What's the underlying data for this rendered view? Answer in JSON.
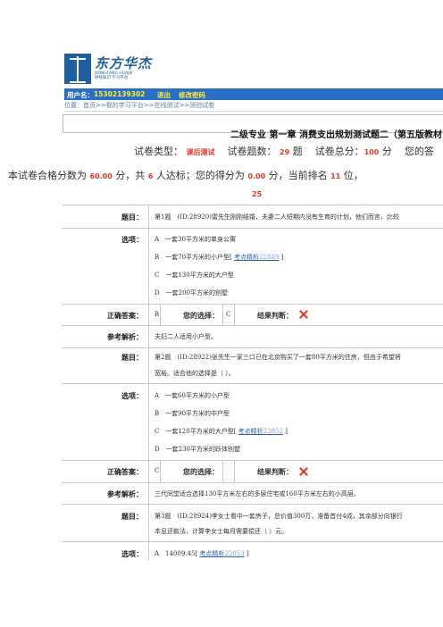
{
  "logo": {
    "name": "东方华杰",
    "tagline_1": "DONGFANG HUAJIE",
    "tagline_2": "财经知识 学习平台"
  },
  "header": {
    "user_label": "用户名：",
    "user_phone": "15302139302",
    "logout": "退出",
    "change_password": "修改密码"
  },
  "breadcrumb": "位置：首页>>我的学习平台>>在线测试>>测验试卷",
  "exam": {
    "title": "二级专业 第一章 消费支出规划测试题二（第五版教材",
    "type_label": "试卷类型：",
    "type_value": "课后测试",
    "count_label": "试卷题数：",
    "count_value": "29",
    "count_unit": "题",
    "total_label": "试卷总分：",
    "total_value": "100",
    "total_unit": "分",
    "your_label": "您的答",
    "pass_label": "本试卷合格分数为",
    "pass_value": "60.00",
    "pass_unit": "分，共",
    "passed_count": "6",
    "passed_text": "人达标；您的得分为",
    "score_value": "0.00",
    "score_text": "分，当前排名",
    "rank_value": "11",
    "rank_unit": "位，",
    "rank_total": "25"
  },
  "labels": {
    "question": "题目：",
    "options": "选项：",
    "correct": "正确答案：",
    "your_choice": "您的选择：",
    "result": "结果判断：",
    "analysis": "参考解析："
  },
  "questions": [
    {
      "text_1": "第1题　(ID:28920)雷先生刚刚结婚，夫妻二人短期内没有生育的计划，他们而言，比较",
      "options": [
        "A　一套30平方米的单身公寓",
        "B　一套70平方米的小户型[",
        "C　一套130平方米的大户型",
        "D　一套200平方米的别墅"
      ],
      "kd_label": "考点精析",
      "kd_num": "22849",
      "kd_close": "]",
      "correct": "B",
      "choice": "C",
      "analysis": "夫妇二人适用小户型。"
    },
    {
      "text_1": "第2题　(ID:28922)张先生一家三口已在北京购买了一套80平方米的住房，但由于希望将",
      "text_2": "宽裕。适合他的选择是（ ）。",
      "options": [
        "A　一套60平方米的小户型",
        "B　一套90平方米的中户型",
        "C　一套120平方米的大户型[",
        "D　一套230平方米的跃体别墅"
      ],
      "kd_label": "考点精析",
      "kd_num": "22852",
      "kd_close": "]",
      "correct": "C",
      "choice": "",
      "analysis": "三代同堂适合选择130平方米左右的多层住宅或160平方米左右的小高层。"
    },
    {
      "text_1": "第3题　(ID:28924)李女士看中一套房子，总价值300万，准备首付4成，其余部分向银行",
      "text_2": "本息还款法，计算李女士每月需要偿还（ ）元。",
      "options": [
        "A　14009.45["
      ],
      "kd_label": "考点精析",
      "kd_num": "22853",
      "kd_close": "]"
    }
  ]
}
